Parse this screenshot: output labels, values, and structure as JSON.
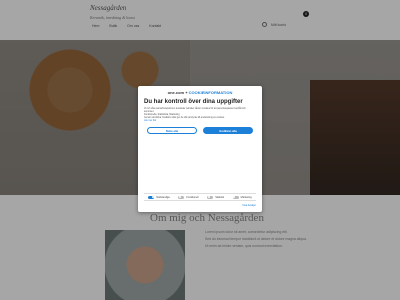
{
  "header": {
    "logo": "Nessagården",
    "tagline": "Keramik, inredning & konst",
    "nav": [
      "Hem",
      "Butik",
      "Om oss",
      "Kontakt"
    ],
    "account": "Mitt konto",
    "cart_count": "0"
  },
  "section": {
    "title": "Om mig och Nessagården",
    "paragraphs": [
      "Lorem ipsum dolor sit amet, consectetur adipiscing elit.",
      "Sed do eiusmod tempor incididunt ut labore et dolore magna aliqua.",
      "Ut enim ad minim veniam, quis nostrud exercitation."
    ]
  },
  "modal": {
    "brand_left": "one.com",
    "brand_right": "COOKIEINFORMATION",
    "title": "Du har kontroll över dina uppgifter",
    "text1": "Vi och våra samarbetspartners använder tekniker såsom cookies för att personanpassa innehåll och annonser.",
    "text2": "Funktionella, Statistiska, Marketing",
    "text3": "Genom att klicka 'Godkänn alla' ger du ditt samtycke till användning av cookies.",
    "link": "Läs mer här",
    "button_reject": "Neka alla",
    "button_accept": "Godkänn alla",
    "toggles": [
      {
        "label": "Nödvändiga",
        "on": true
      },
      {
        "label": "Funktionell",
        "on": false
      },
      {
        "label": "Statistik",
        "on": false
      },
      {
        "label": "Marketing",
        "on": false
      }
    ],
    "details": "Visa detaljer"
  }
}
